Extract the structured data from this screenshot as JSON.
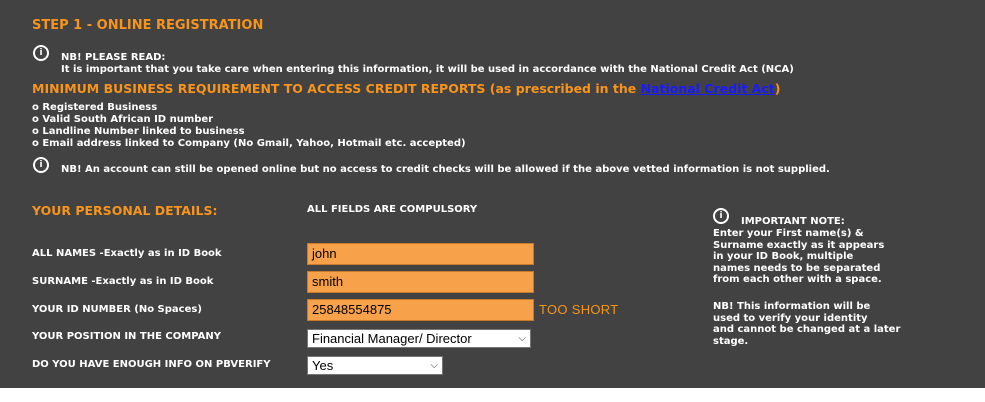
{
  "step_title": "STEP 1 - ONLINE REGISTRATION",
  "nb_read": {
    "title": "NB! PLEASE READ:",
    "text": "It is important that you take care when entering this information, it will be used in accordance with the National Credit Act (NCA)"
  },
  "min_requirement": {
    "prefix": "MINIMUM BUSINESS REQUIREMENT TO ACCESS CREDIT REPORTS",
    "paren_open": " (as prescribed in the ",
    "link": "National Credit Act",
    "paren_close": ")"
  },
  "requirements": [
    "o Registered Business",
    "o Valid South African ID number",
    "o Landline Number linked to business",
    "o Email address linked to Company (No Gmail, Yahoo, Hotmail etc. accepted)"
  ],
  "nb_account": "NB! An account can still be opened online but no access to credit checks will be allowed if the above vetted information is not supplied.",
  "personal_details": {
    "title": "YOUR PERSONAL DETAILS:",
    "compulsory": "ALL FIELDS ARE COMPULSORY"
  },
  "form": {
    "names_label": "ALL NAMES -Exactly as in ID Book",
    "names_value": "john",
    "surname_label": "SURNAME -Exactly as in ID Book",
    "surname_value": "smith",
    "id_label": "YOUR ID NUMBER (No Spaces)",
    "id_value": "25848554875",
    "id_error": "TOO SHORT",
    "position_label": "YOUR POSITION IN THE COMPANY",
    "position_value": "Financial Manager/ Director",
    "info_label": "DO YOU HAVE ENOUGH INFO ON PBVERIFY",
    "info_value": "Yes"
  },
  "important_note": {
    "title": "IMPORTANT NOTE:",
    "lines": [
      "Enter your First name(s) &",
      "Surname exactly as it appears",
      "in your ID Book, multiple",
      "names needs to be separated",
      "from each other with a space."
    ],
    "nb_lines": [
      "NB!  This information will be",
      "used to verify your identity",
      "and cannot be changed at a later",
      "stage."
    ]
  },
  "colors": {
    "background": "#424242",
    "accent": "#f7941d",
    "input_fill": "#f7a14a",
    "link": "#1a1aff"
  },
  "icons": {
    "info": "info-icon"
  }
}
